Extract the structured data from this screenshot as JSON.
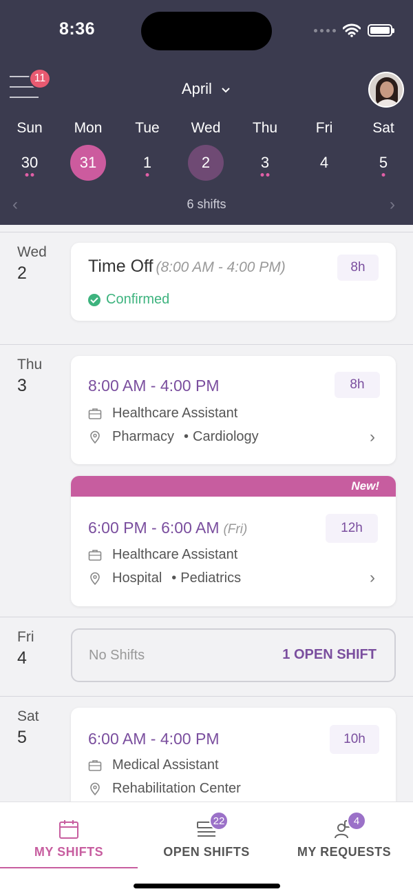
{
  "status": {
    "time": "8:36"
  },
  "header": {
    "menu_badge": "11",
    "month": "April",
    "weekdays": [
      "Sun",
      "Mon",
      "Tue",
      "Wed",
      "Thu",
      "Fri",
      "Sat"
    ],
    "days": [
      "30",
      "31",
      "1",
      "2",
      "3",
      "4",
      "5"
    ],
    "shift_count": "6 shifts"
  },
  "list": {
    "wed": {
      "label": "Wed",
      "num": "2"
    },
    "thu": {
      "label": "Thu",
      "num": "3"
    },
    "fri": {
      "label": "Fri",
      "num": "4"
    },
    "sat": {
      "label": "Sat",
      "num": "5"
    },
    "time_off": {
      "title": "Time Off",
      "range": "(8:00 AM - 4:00 PM)",
      "hours": "8h",
      "status": "Confirmed"
    },
    "shift1": {
      "time": "8:00 AM - 4:00 PM",
      "hours": "8h",
      "role": "Healthcare Assistant",
      "location": "Pharmacy",
      "dept": "Cardiology"
    },
    "shift2": {
      "new": "New!",
      "time": "6:00 PM - 6:00 AM",
      "note": "(Fri)",
      "hours": "12h",
      "role": "Healthcare Assistant",
      "location": "Hospital",
      "dept": "Pediatrics"
    },
    "no_shifts": {
      "label": "No Shifts",
      "action": "1 OPEN SHIFT"
    },
    "shift3": {
      "time": "6:00 AM - 4:00 PM",
      "hours": "10h",
      "role": "Medical Assistant",
      "location": "Rehabilitation Center"
    }
  },
  "tabs": {
    "my_shifts": "MY SHIFTS",
    "open_shifts": "OPEN SHIFTS",
    "open_shifts_badge": "22",
    "my_requests": "MY REQUESTS",
    "my_requests_badge": "4"
  },
  "colors": {
    "header_bg": "#3b3b4f",
    "accent": "#c75d9f",
    "purple": "#7a4e9e",
    "confirmed": "#3db37e"
  }
}
